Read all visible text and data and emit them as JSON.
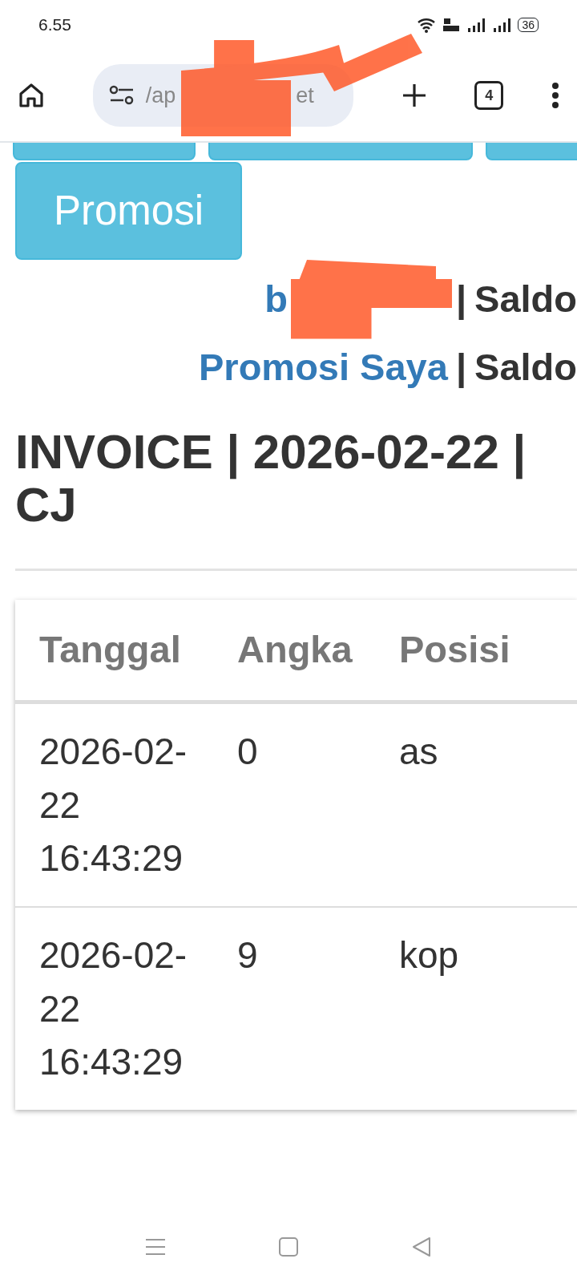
{
  "status_bar": {
    "time": "6.55",
    "battery": "36"
  },
  "browser": {
    "url_start": "/ap",
    "url_end": "et",
    "tab_count": "4"
  },
  "buttons": [
    {
      "label": "Promosi"
    }
  ],
  "user_line": {
    "link": "b",
    "separator": "|",
    "label": "Saldo"
  },
  "promo_line": {
    "link": "Promosi Saya",
    "separator": "|",
    "label": "Saldo"
  },
  "heading": {
    "line_1": "INVOICE | 2026-02-22 |",
    "line_2": "CJ"
  },
  "table": {
    "columns": [
      "Tanggal",
      "Angka",
      "Posisi"
    ],
    "rows": [
      {
        "cells": [
          "2026-02-22 16:43:29",
          "0",
          "as"
        ]
      },
      {
        "cells": [
          "2026-02-22 16:43:29",
          "9",
          "kop"
        ]
      }
    ]
  }
}
